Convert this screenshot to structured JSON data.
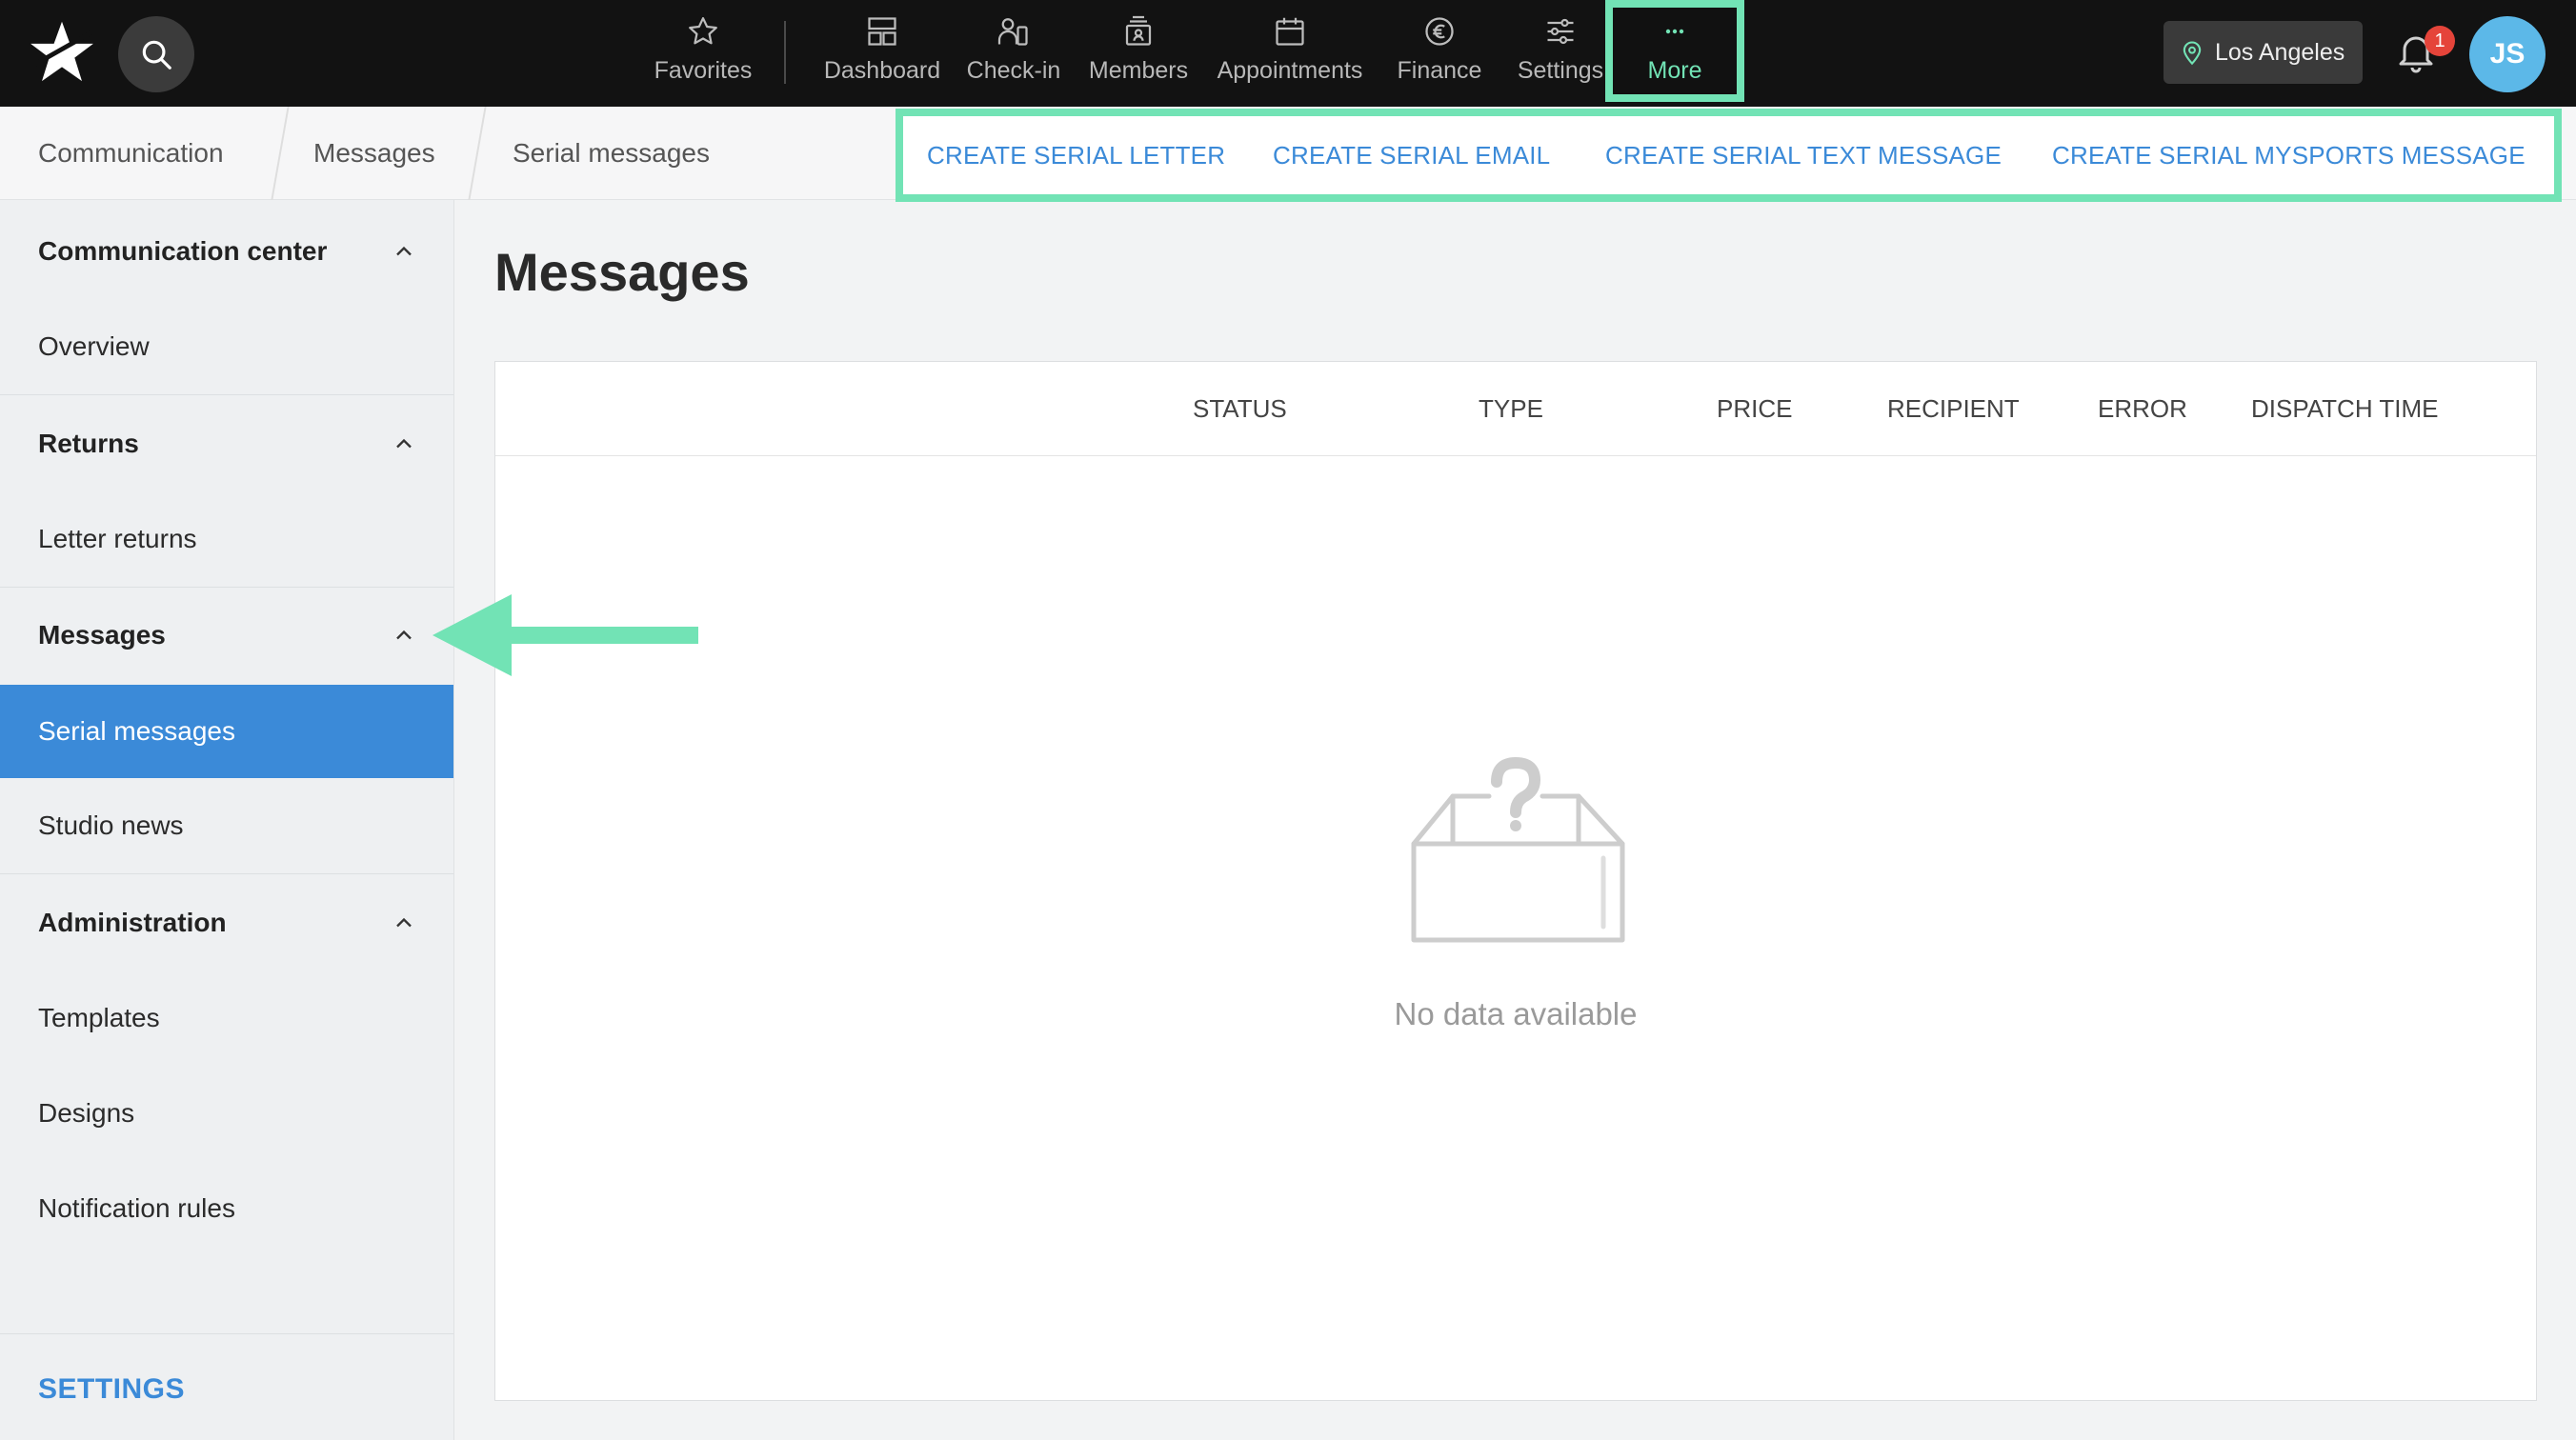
{
  "topbar": {
    "logo_icon": "star-logo-icon",
    "search_icon": "search-icon",
    "nav": [
      {
        "label": "Favorites",
        "icon": "star-icon"
      },
      {
        "label": "Dashboard",
        "icon": "dashboard-icon"
      },
      {
        "label": "Check-in",
        "icon": "check-in-icon"
      },
      {
        "label": "Members",
        "icon": "members-icon"
      },
      {
        "label": "Appointments",
        "icon": "calendar-icon"
      },
      {
        "label": "Finance",
        "icon": "euro-icon"
      },
      {
        "label": "Settings",
        "icon": "sliders-icon"
      },
      {
        "label": "More",
        "icon": "more-dots-icon",
        "highlighted": true
      }
    ],
    "location": {
      "label": "Los Angeles",
      "icon": "location-pin-icon"
    },
    "notifications": {
      "icon": "bell-icon",
      "count": "1"
    },
    "user": {
      "initials": "JS"
    }
  },
  "breadcrumb": [
    "Communication",
    "Messages",
    "Serial messages"
  ],
  "actions": {
    "highlighted": true,
    "items": [
      "CREATE SERIAL LETTER",
      "CREATE SERIAL EMAIL",
      "CREATE SERIAL TEXT MESSAGE",
      "CREATE SERIAL MYSPORTS MESSAGE"
    ]
  },
  "sidebar": {
    "groups": [
      {
        "title": "Communication center",
        "expanded": true,
        "items": [
          {
            "label": "Overview"
          }
        ]
      },
      {
        "title": "Returns",
        "expanded": true,
        "items": [
          {
            "label": "Letter returns"
          }
        ]
      },
      {
        "title": "Messages",
        "expanded": true,
        "items": [
          {
            "label": "Serial messages",
            "active": true
          },
          {
            "label": "Studio news"
          }
        ]
      },
      {
        "title": "Administration",
        "expanded": true,
        "items": [
          {
            "label": "Templates"
          },
          {
            "label": "Designs"
          },
          {
            "label": "Notification rules"
          }
        ]
      }
    ],
    "settings_label": "SETTINGS"
  },
  "main": {
    "title": "Messages",
    "table": {
      "columns": [
        "STATUS",
        "TYPE",
        "PRICE",
        "RECIPIENT",
        "ERROR",
        "DISPATCH TIME"
      ],
      "rows": [],
      "empty_state": {
        "icon": "empty-box-icon",
        "text": "No data available"
      }
    }
  },
  "colors": {
    "topbar_bg": "#121212",
    "accent_blue": "#3b8ad8",
    "highlight_green": "#72e3b5",
    "badge_red": "#e5443a",
    "avatar_bg": "#5cb8e8"
  }
}
